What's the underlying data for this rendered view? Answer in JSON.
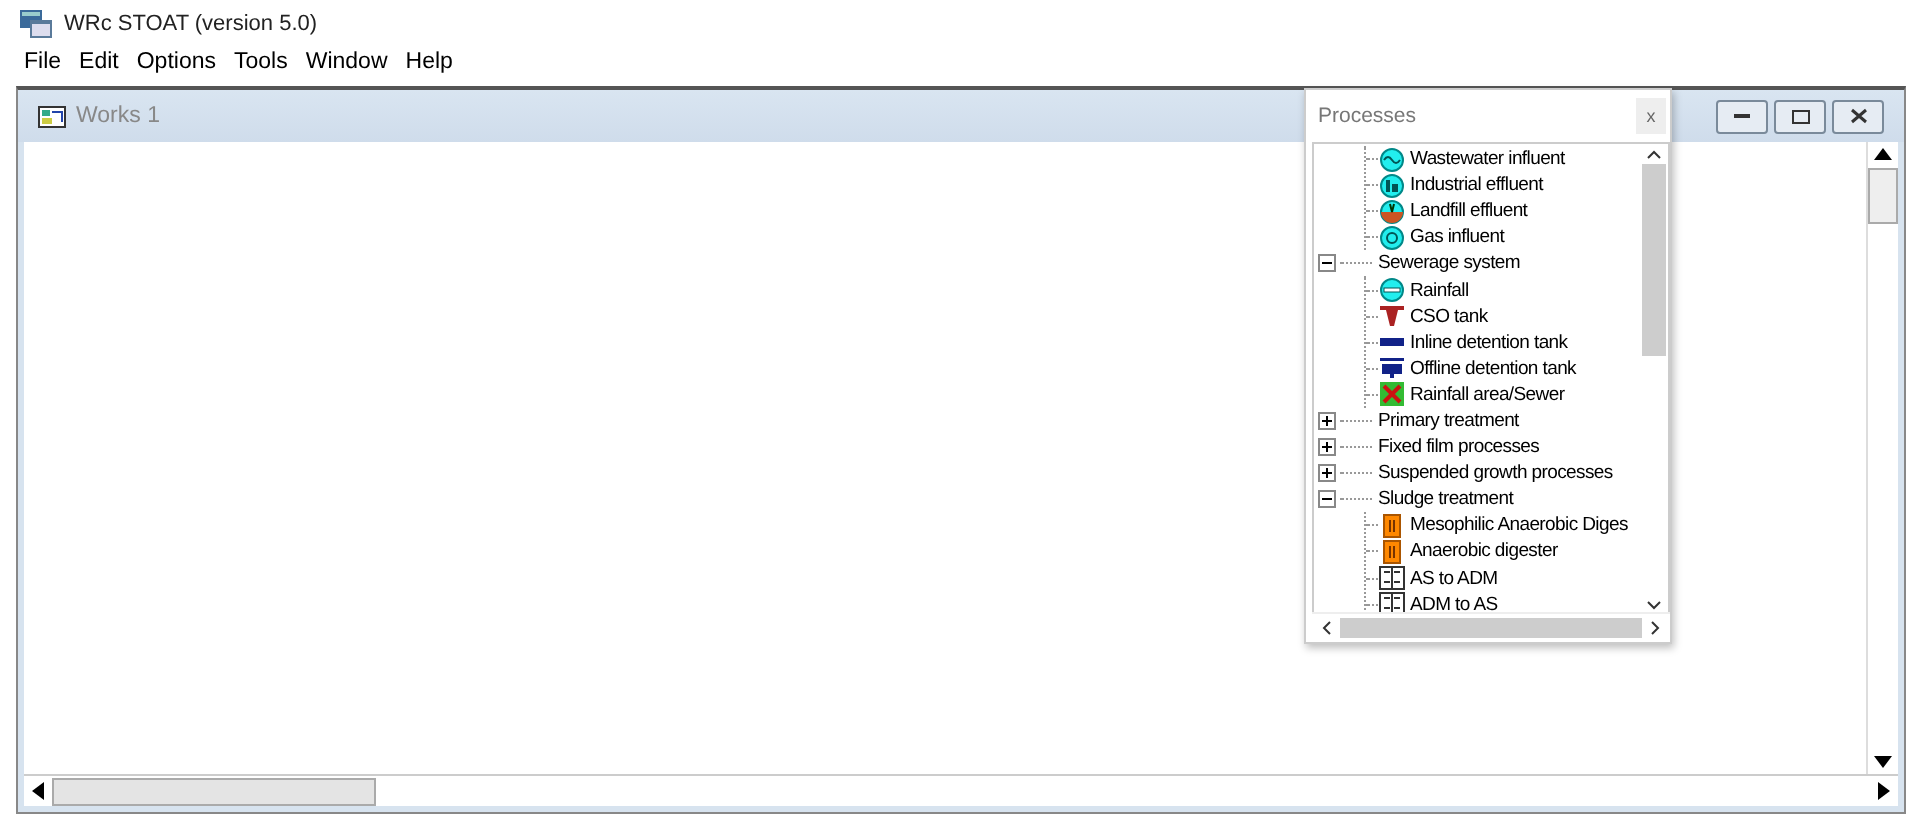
{
  "window": {
    "title": "WRc STOAT (version 5.0)"
  },
  "menu": [
    "File",
    "Edit",
    "Options",
    "Tools",
    "Window",
    "Help"
  ],
  "document": {
    "title": "Works 1"
  },
  "processes": {
    "title": "Processes",
    "close": "x",
    "tree": [
      {
        "expanded": true,
        "children": [
          {
            "label": "Wastewater influent",
            "kind": "wastewater"
          },
          {
            "label": "Industrial effluent",
            "kind": "industrial"
          },
          {
            "label": "Landfill effluent",
            "kind": "landfill"
          },
          {
            "label": "Gas influent",
            "kind": "gas"
          }
        ]
      },
      {
        "label": "Sewerage system",
        "expanded": true,
        "children": [
          {
            "label": "Rainfall",
            "kind": "rainfall"
          },
          {
            "label": "CSO tank",
            "kind": "cso"
          },
          {
            "label": "Inline detention tank",
            "kind": "inline"
          },
          {
            "label": "Offline detention tank",
            "kind": "offline"
          },
          {
            "label": "Rainfall area/Sewer",
            "kind": "area"
          }
        ]
      },
      {
        "label": "Primary treatment",
        "expanded": false
      },
      {
        "label": "Fixed film processes",
        "expanded": false
      },
      {
        "label": "Suspended growth processes",
        "expanded": false
      },
      {
        "label": "Sludge treatment",
        "expanded": true,
        "children": [
          {
            "label": "Mesophilic Anaerobic Diges",
            "kind": "digester"
          },
          {
            "label": "Anaerobic digester",
            "kind": "digester"
          },
          {
            "label": "AS to ADM",
            "kind": "converter"
          },
          {
            "label": "ADM to AS",
            "kind": "converter"
          }
        ]
      }
    ]
  }
}
